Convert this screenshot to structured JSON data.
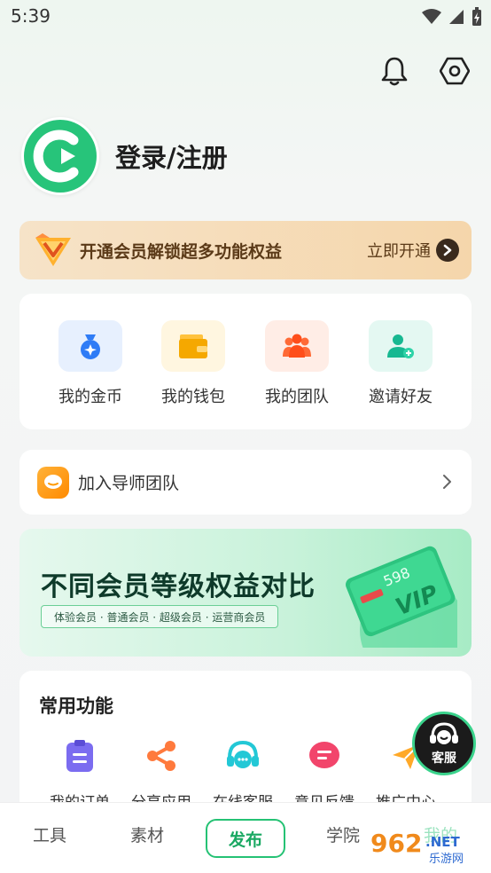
{
  "status_bar": {
    "time": "5:39"
  },
  "profile": {
    "login_label": "登录/注册"
  },
  "vip_bar": {
    "text": "开通会员解锁超多功能权益",
    "action": "立即开通"
  },
  "wallet": [
    {
      "label": "我的金币",
      "icon": "money-bag-icon",
      "tile_color": "#e7f0fe"
    },
    {
      "label": "我的钱包",
      "icon": "wallet-icon",
      "tile_color": "#fff6e0"
    },
    {
      "label": "我的团队",
      "icon": "team-icon",
      "tile_color": "#ffede6"
    },
    {
      "label": "邀请好友",
      "icon": "invite-friend-icon",
      "tile_color": "#e4f8f2"
    }
  ],
  "mentor": {
    "label": "加入导师团队"
  },
  "banner": {
    "title": "不同会员等级权益对比",
    "subtitle": "体验会员 · 普通会员 · 超级会员 · 运营商会员",
    "card_price": "598",
    "card_text": "VIP"
  },
  "functions": {
    "title": "常用功能",
    "items": [
      {
        "label": "我的订单",
        "icon": "order-clipboard-icon",
        "color": "#7b6cf0"
      },
      {
        "label": "分享应用",
        "icon": "share-icon",
        "color": "#ff7a3d"
      },
      {
        "label": "在线客服",
        "icon": "headset-icon",
        "color": "#23c8d6"
      },
      {
        "label": "意见反馈",
        "icon": "feedback-icon",
        "color": "#f2456b"
      },
      {
        "label": "推广中心",
        "icon": "promotion-icon",
        "color": "#ffa928"
      }
    ]
  },
  "service_float": {
    "label": "客服"
  },
  "tabbar": {
    "tools": "工具",
    "materials": "素材",
    "publish": "发布",
    "academy": "学院",
    "mine": "我的"
  },
  "watermark": {
    "text": "962",
    "suffix": ".NET",
    "sub": "乐游网"
  },
  "colors": {
    "brand_green": "#25c274",
    "vip_gold": "#f5d6ab"
  }
}
